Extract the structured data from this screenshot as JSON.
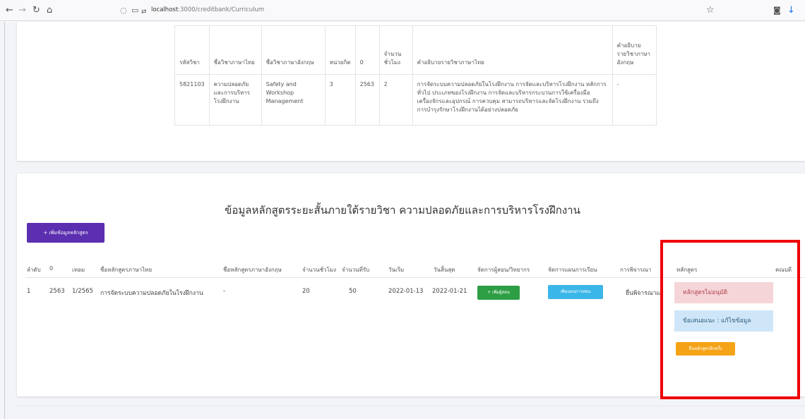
{
  "browser": {
    "url_host": "localhost",
    "url_path": ":3000/creditbank/Curriculum"
  },
  "course_table": {
    "headers": [
      "รหัสวิชา",
      "ชื่อวิชาภาษาไทย",
      "ชื่อวิชาภาษาอังกฤษ",
      "หน่วยกิต",
      "0",
      "จำนวนชั่วโมง",
      "คำอธิบายรายวิชาภาษาไทย",
      "คำอธิบายรายวิชาภาษาอังกฤษ"
    ],
    "row": {
      "code": "5821103",
      "name_th": "ความปลอดภัยและการบริหารโรงฝึกงาน",
      "name_en": "Safety and Workshop Management",
      "credits": "3",
      "year": "2563",
      "hours": "2",
      "desc_th": "การจัดระบบความปลอดภัยในโรงฝึกงาน การจัดและบริหารโรงฝึกงาน หลักการทั่วไป ประเภทของโรงฝึกงาน การจัดและบริหารกระบวนการใช้เครื่องมือ เครื่องจักรและอุปกรณ์ การควบคุม สามารถบริหารและจัดโรงฝึกงาน รวมถึงการบำรุงรักษาโรงฝึกงานได้อย่างปลอดภัย",
      "desc_en": "-"
    }
  },
  "section": {
    "title": "ข้อมูลหลักสูตรระยะสั้นภายใต้รายวิชา ความปลอดภัยและการบริหารโรงฝึกงาน",
    "add_button": "+ เพิ่มข้อมูลหลักสูตร"
  },
  "curriculum_table": {
    "headers": [
      "ลำดับ",
      "0",
      "เทอม",
      "ชื่อหลักสูตรภาษาไทย",
      "ชื่อหลักสูตรภาษาอังกฤษ",
      "จำนวนชั่วโมง",
      "จำนวนที่รับ",
      "วันเริ่ม",
      "วันสิ้นสุด",
      "จัดการผู้สอน/วิทยากร",
      "จัดการแผนการเรียน",
      "การพิจารณา",
      "หลักสูตร",
      "คณบดี"
    ],
    "row": {
      "index": "1",
      "year": "2563",
      "term": "1/2565",
      "name_th": "การจัดระบบความปลอดภัยในโรงฝึกงาน",
      "name_en": "-",
      "hours": "20",
      "capacity": "50",
      "start": "2022-01-13",
      "end": "2022-01-21",
      "teacher_btn": "+ เพิ่มผู้สอน",
      "plan_btn": "เพิ่มแผนการสอน",
      "review": "ยื่นพิจารณาแล้ว",
      "status_rejected": "หลักสูตรไม่อนุมัติ",
      "status_suggest": "ข้อเสนอแนะ : แก้ไขข้อมูล",
      "resubmit_btn": "ยื่นหลักสูตรอีกครั้ง"
    }
  },
  "colors": {
    "purple": "#5b2fb0",
    "green": "#2e9e45",
    "cyan": "#3bb6e8",
    "orange": "#f5a316",
    "highlight": "#ee0000"
  }
}
